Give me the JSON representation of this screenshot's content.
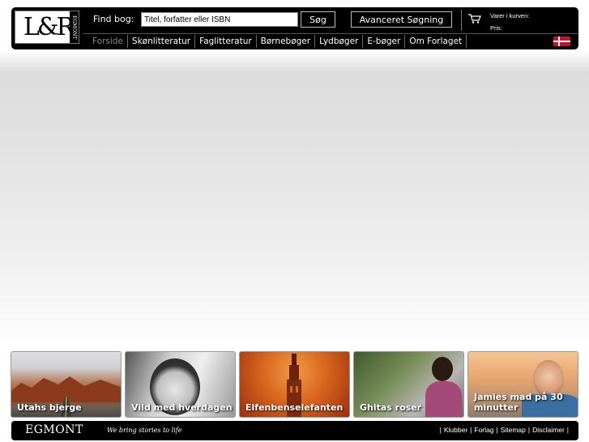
{
  "header": {
    "logo_text": "L&R",
    "logo_vertical": "EGMONT",
    "find_label": "Find bog:",
    "search_placeholder": "Titel, forfatter eller ISBN",
    "search_button": "Søg",
    "advanced_button": "Avanceret Søgning",
    "cart_items_label": "Varer i kurven:",
    "cart_price_label": "Pris:"
  },
  "nav": {
    "items": [
      {
        "label": "Forside",
        "active": true
      },
      {
        "label": "Skønlitteratur"
      },
      {
        "label": "Faglitteratur"
      },
      {
        "label": "Børnebøger"
      },
      {
        "label": "Lydbøger"
      },
      {
        "label": "E-bøger"
      },
      {
        "label": "Om Forlaget"
      }
    ]
  },
  "tiles": [
    {
      "label": "Utahs bjerge"
    },
    {
      "label": "Vild med hverdagen"
    },
    {
      "label": "Elfenbenselefanten"
    },
    {
      "label": "Ghitas roser"
    },
    {
      "label": "Jamies mad på 30 minutter"
    }
  ],
  "footer": {
    "logo": "EGMONT",
    "slogan": "We bring stories to life",
    "links": [
      "Klubber",
      "Forlag",
      "Sitemap",
      "Disclaimer"
    ],
    "separator": "|"
  },
  "colors": {
    "bar": "#000000",
    "flag_red": "#c8102e",
    "active_nav": "#8a8a8a"
  }
}
